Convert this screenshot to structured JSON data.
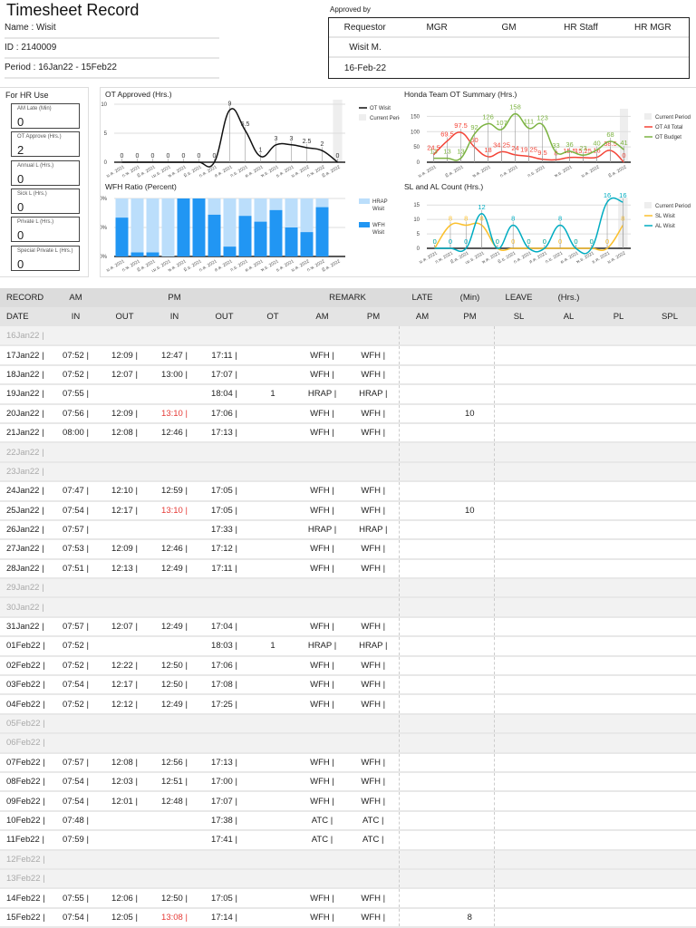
{
  "header": {
    "title": "Timesheet Record",
    "name": "Name : Wisit",
    "id": "ID : 2140009",
    "period": "Period : 16Jan22 - 15Feb22"
  },
  "approval": {
    "label": "Approved by",
    "columns": [
      "Requestor",
      "MGR",
      "GM",
      "HR Staff",
      "HR MGR"
    ],
    "requestor_name": "Wisit M.",
    "requestor_date": "16-Feb-22"
  },
  "hr_use": {
    "title": "For HR Use",
    "fields": [
      {
        "label": "AM Late (Min)",
        "value": "0"
      },
      {
        "label": "OT Approve (Hrs.)",
        "value": "2"
      },
      {
        "label": "Annual L (Hrs.)",
        "value": "0"
      },
      {
        "label": "Sick L (Hrs.)",
        "value": "0"
      },
      {
        "label": "Private L (Hrs.)",
        "value": "0"
      },
      {
        "label": "Special Private L (Hrs.)",
        "value": "0"
      }
    ]
  },
  "chart_data": [
    {
      "type": "line",
      "title": "OT Approved (Hrs.)",
      "x": [
        "ม.ค. 2021",
        "ก.พ. 2021",
        "มี.ค. 2021",
        "เม.ย. 2021",
        "พ.ค. 2021",
        "มิ.ย. 2021",
        "ก.ค. 2021",
        "ส.ค. 2021",
        "ก.ย. 2021",
        "ต.ค. 2021",
        "พ.ย. 2021",
        "ธ.ค. 2021",
        "ม.ค. 2022",
        "ก.พ. 2022",
        "มี.ค. 2022"
      ],
      "yticks": [
        "0",
        "5",
        "10"
      ],
      "ylim": [
        0,
        10
      ],
      "series": [
        {
          "name": "OT Wisit",
          "color": "#111111",
          "values": [
            0,
            0,
            0,
            0,
            0,
            0,
            0,
            9,
            5.5,
            1,
            3,
            3,
            2.5,
            2,
            0
          ]
        }
      ],
      "legend": [
        "OT Wisit",
        "Current Period"
      ]
    },
    {
      "type": "bar",
      "stacked": true,
      "title": "WFH Ratio (Percent)",
      "x": [
        "ม.ค. 2021",
        "ก.พ. 2021",
        "มี.ค. 2021",
        "เม.ย. 2021",
        "พ.ค. 2021",
        "มิ.ย. 2021",
        "ก.ค. 2021",
        "ส.ค. 2021",
        "ก.ย. 2021",
        "ต.ค. 2021",
        "พ.ย. 2021",
        "ธ.ค. 2021",
        "ม.ค. 2022",
        "ก.พ. 2022",
        "มี.ค. 2022"
      ],
      "yticks": [
        "0%",
        "50%",
        "100%"
      ],
      "ylim": [
        0,
        100
      ],
      "series": [
        {
          "name": "WFH Wisit",
          "color": "#2196f3",
          "values": [
            67,
            7,
            7,
            0,
            100,
            100,
            72,
            17,
            70,
            60,
            80,
            50,
            42,
            85
          ]
        },
        {
          "name": "HRAP Wisit",
          "color": "#bbdefb",
          "values": [
            33,
            93,
            93,
            100,
            0,
            0,
            28,
            83,
            30,
            40,
            20,
            50,
            58,
            15
          ]
        }
      ]
    },
    {
      "type": "line",
      "title": "Honda Team OT Summary (Hrs.)",
      "x": [
        "ม.ค. 2021",
        "ก.พ. 2021",
        "มี.ค. 2021",
        "เม.ย. 2021",
        "พ.ค. 2021",
        "มิ.ย. 2021",
        "ก.ค. 2021",
        "ส.ค. 2021",
        "ก.ย. 2021",
        "ต.ค. 2021",
        "พ.ย. 2021",
        "ธ.ค. 2021",
        "ม.ค. 2022",
        "ก.พ. 2022",
        "มี.ค. 2022"
      ],
      "yticks": [
        "0",
        "50",
        "100",
        "150"
      ],
      "ylim": [
        0,
        160
      ],
      "series": [
        {
          "name": "OT All Total",
          "color": "#f44336",
          "values": [
            24.5,
            69.5,
            97.5,
            50,
            18,
            34.25,
            24,
            19.25,
            9.5,
            8,
            15.5,
            15.25,
            16,
            38.5,
            0
          ]
        },
        {
          "name": "OT Budget",
          "color": "#7cb342",
          "values": [
            13,
            13,
            13,
            92,
            126,
            107,
            158,
            111,
            123,
            33,
            36,
            23,
            40,
            68,
            41
          ]
        }
      ],
      "legend": [
        "Current Period",
        "OT All Total",
        "OT Budget"
      ]
    },
    {
      "type": "line",
      "title": "SL and AL Count (Hrs.)",
      "x": [
        "ม.ค. 2021",
        "ก.พ. 2021",
        "มี.ค. 2021",
        "เม.ย. 2021",
        "พ.ค. 2021",
        "มิ.ย. 2021",
        "ก.ค. 2021",
        "ส.ค. 2021",
        "ก.ย. 2021",
        "ต.ค. 2021",
        "พ.ย. 2021",
        "ธ.ค. 2021",
        "ม.ค. 2022"
      ],
      "yticks": [
        "0",
        "5",
        "10",
        "15"
      ],
      "ylim": [
        0,
        16
      ],
      "series": [
        {
          "name": "SL Wisit",
          "color": "#fbc02d",
          "values": [
            0,
            8,
            8,
            8,
            0,
            0,
            0,
            0,
            0,
            0,
            0,
            0,
            8
          ]
        },
        {
          "name": "AL Wisit",
          "color": "#00acc1",
          "values": [
            0,
            0,
            0,
            12,
            0,
            8,
            0,
            0,
            8,
            0,
            0,
            16,
            16
          ]
        }
      ],
      "legend": [
        "Current Period",
        "SL Wisit",
        "AL Wisit"
      ]
    }
  ],
  "table": {
    "group_headers": [
      "RECORD",
      "AM",
      "PM",
      "REMARK",
      "LATE",
      "(Min)",
      "LEAVE",
      "(Hrs.)"
    ],
    "columns": [
      "DATE",
      "IN",
      "OUT",
      "IN",
      "OUT",
      "OT",
      "AM",
      "PM",
      "AM",
      "PM",
      "SL",
      "AL",
      "PL",
      "SPL"
    ],
    "rows": [
      {
        "date": "16Jan22 |",
        "weekend": true
      },
      {
        "date": "17Jan22 |",
        "am_in": "07:52 |",
        "am_out": "12:09 |",
        "pm_in": "12:47 |",
        "pm_out": "17:11 |",
        "rem_am": "WFH |",
        "rem_pm": "WFH |"
      },
      {
        "date": "18Jan22 |",
        "am_in": "07:52 |",
        "am_out": "12:07 |",
        "pm_in": "13:00 |",
        "pm_out": "17:07 |",
        "rem_am": "WFH |",
        "rem_pm": "WFH |"
      },
      {
        "date": "19Jan22 |",
        "am_in": "07:55 |",
        "pm_out": "18:04 |",
        "ot": "1",
        "rem_am": "HRAP |",
        "rem_pm": "HRAP |"
      },
      {
        "date": "20Jan22 |",
        "am_in": "07:56 |",
        "am_out": "12:09 |",
        "pm_in": "13:10 |",
        "pm_in_late": true,
        "pm_out": "17:06 |",
        "rem_am": "WFH |",
        "rem_pm": "WFH |",
        "late_pm": "10"
      },
      {
        "date": "21Jan22 |",
        "am_in": "08:00 |",
        "am_out": "12:08 |",
        "pm_in": "12:46 |",
        "pm_out": "17:13 |",
        "rem_am": "WFH |",
        "rem_pm": "WFH |"
      },
      {
        "date": "22Jan22 |",
        "weekend": true
      },
      {
        "date": "23Jan22 |",
        "weekend": true
      },
      {
        "date": "24Jan22 |",
        "am_in": "07:47 |",
        "am_out": "12:10 |",
        "pm_in": "12:59 |",
        "pm_out": "17:05 |",
        "rem_am": "WFH |",
        "rem_pm": "WFH |"
      },
      {
        "date": "25Jan22 |",
        "am_in": "07:54 |",
        "am_out": "12:17 |",
        "pm_in": "13:10 |",
        "pm_in_late": true,
        "pm_out": "17:05 |",
        "rem_am": "WFH |",
        "rem_pm": "WFH |",
        "late_pm": "10"
      },
      {
        "date": "26Jan22 |",
        "am_in": "07:57 |",
        "pm_out": "17:33 |",
        "rem_am": "HRAP |",
        "rem_pm": "HRAP |"
      },
      {
        "date": "27Jan22 |",
        "am_in": "07:53 |",
        "am_out": "12:09 |",
        "pm_in": "12:46 |",
        "pm_out": "17:12 |",
        "rem_am": "WFH |",
        "rem_pm": "WFH |"
      },
      {
        "date": "28Jan22 |",
        "am_in": "07:51 |",
        "am_out": "12:13 |",
        "pm_in": "12:49 |",
        "pm_out": "17:11 |",
        "rem_am": "WFH |",
        "rem_pm": "WFH |"
      },
      {
        "date": "29Jan22 |",
        "weekend": true
      },
      {
        "date": "30Jan22 |",
        "weekend": true
      },
      {
        "date": "31Jan22 |",
        "am_in": "07:57 |",
        "am_out": "12:07 |",
        "pm_in": "12:49 |",
        "pm_out": "17:04 |",
        "rem_am": "WFH |",
        "rem_pm": "WFH |"
      },
      {
        "date": "01Feb22 |",
        "am_in": "07:52 |",
        "pm_out": "18:03 |",
        "ot": "1",
        "rem_am": "HRAP |",
        "rem_pm": "HRAP |"
      },
      {
        "date": "02Feb22 |",
        "am_in": "07:52 |",
        "am_out": "12:22 |",
        "pm_in": "12:50 |",
        "pm_out": "17:06 |",
        "rem_am": "WFH |",
        "rem_pm": "WFH |"
      },
      {
        "date": "03Feb22 |",
        "am_in": "07:54 |",
        "am_out": "12:17 |",
        "pm_in": "12:50 |",
        "pm_out": "17:08 |",
        "rem_am": "WFH |",
        "rem_pm": "WFH |"
      },
      {
        "date": "04Feb22 |",
        "am_in": "07:52 |",
        "am_out": "12:12 |",
        "pm_in": "12:49 |",
        "pm_out": "17:25 |",
        "rem_am": "WFH |",
        "rem_pm": "WFH |"
      },
      {
        "date": "05Feb22 |",
        "weekend": true
      },
      {
        "date": "06Feb22 |",
        "weekend": true
      },
      {
        "date": "07Feb22 |",
        "am_in": "07:57 |",
        "am_out": "12:08 |",
        "pm_in": "12:56 |",
        "pm_out": "17:13 |",
        "rem_am": "WFH |",
        "rem_pm": "WFH |"
      },
      {
        "date": "08Feb22 |",
        "am_in": "07:54 |",
        "am_out": "12:03 |",
        "pm_in": "12:51 |",
        "pm_out": "17:00 |",
        "rem_am": "WFH |",
        "rem_pm": "WFH |"
      },
      {
        "date": "09Feb22 |",
        "am_in": "07:54 |",
        "am_out": "12:01 |",
        "pm_in": "12:48 |",
        "pm_out": "17:07 |",
        "rem_am": "WFH |",
        "rem_pm": "WFH |"
      },
      {
        "date": "10Feb22 |",
        "am_in": "07:48 |",
        "pm_out": "17:38 |",
        "rem_am": "ATC |",
        "rem_pm": "ATC |"
      },
      {
        "date": "11Feb22 |",
        "am_in": "07:59 |",
        "pm_out": "17:41 |",
        "rem_am": "ATC |",
        "rem_pm": "ATC |"
      },
      {
        "date": "12Feb22 |",
        "weekend": true
      },
      {
        "date": "13Feb22 |",
        "weekend": true
      },
      {
        "date": "14Feb22 |",
        "am_in": "07:55 |",
        "am_out": "12:06 |",
        "pm_in": "12:50 |",
        "pm_out": "17:05 |",
        "rem_am": "WFH |",
        "rem_pm": "WFH |"
      },
      {
        "date": "15Feb22 |",
        "am_in": "07:54 |",
        "am_out": "12:05 |",
        "pm_in": "13:08 |",
        "pm_in_late": true,
        "pm_out": "17:14 |",
        "rem_am": "WFH |",
        "rem_pm": "WFH |",
        "late_pm": "8"
      }
    ]
  }
}
